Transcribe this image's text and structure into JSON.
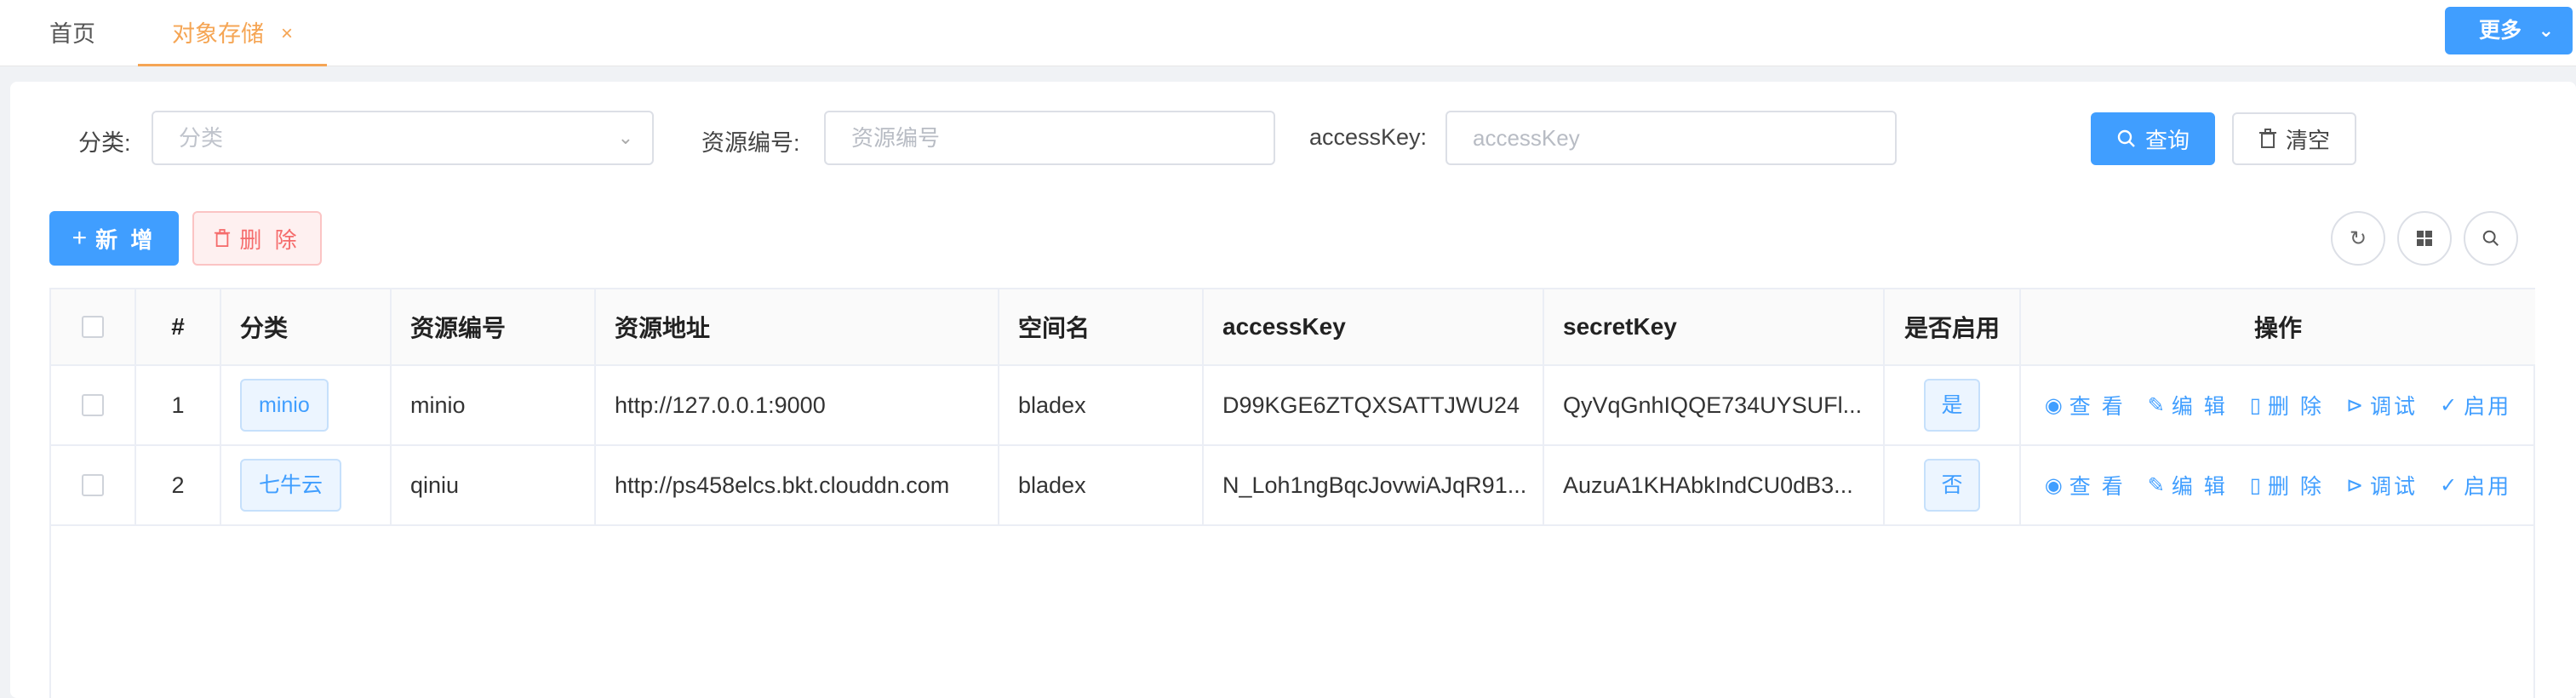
{
  "tabs": {
    "home": "首页",
    "active": "对象存储",
    "close_glyph": "×",
    "more": "更多"
  },
  "search": {
    "category_label": "分类:",
    "category_placeholder": "分类",
    "resource_label": "资源编号:",
    "resource_placeholder": "资源编号",
    "accesskey_label": "accessKey:",
    "accesskey_placeholder": "accessKey",
    "query_label": "查询",
    "clear_label": "清空"
  },
  "toolbar": {
    "add_label": "新 增",
    "delete_label": "删 除"
  },
  "table": {
    "headers": [
      "#",
      "分类",
      "资源编号",
      "资源地址",
      "空间名",
      "accessKey",
      "secretKey",
      "是否启用",
      "操作"
    ],
    "rows": [
      {
        "index": "1",
        "category": "minio",
        "resource": "minio",
        "address": "http://127.0.0.1:9000",
        "space": "bladex",
        "accessKey": "D99KGE6ZTQXSATTJWU24",
        "secretKey": "QyVqGnhIQQE734UYSUFl...",
        "enabled": "是"
      },
      {
        "index": "2",
        "category": "七牛云",
        "resource": "qiniu",
        "address": "http://ps458elcs.bkt.clouddn.com",
        "space": "bladex",
        "accessKey": "N_Loh1ngBqcJovwiAJqR91...",
        "secretKey": "AuzuA1KHAbkIndCU0dB3...",
        "enabled": "否"
      }
    ],
    "actions": [
      "查 看",
      "编 辑",
      "删 除",
      "调试",
      "启用"
    ]
  },
  "colors": {
    "primary": "#409eff",
    "active_tab": "#f5a554",
    "danger": "#f56c6c"
  }
}
